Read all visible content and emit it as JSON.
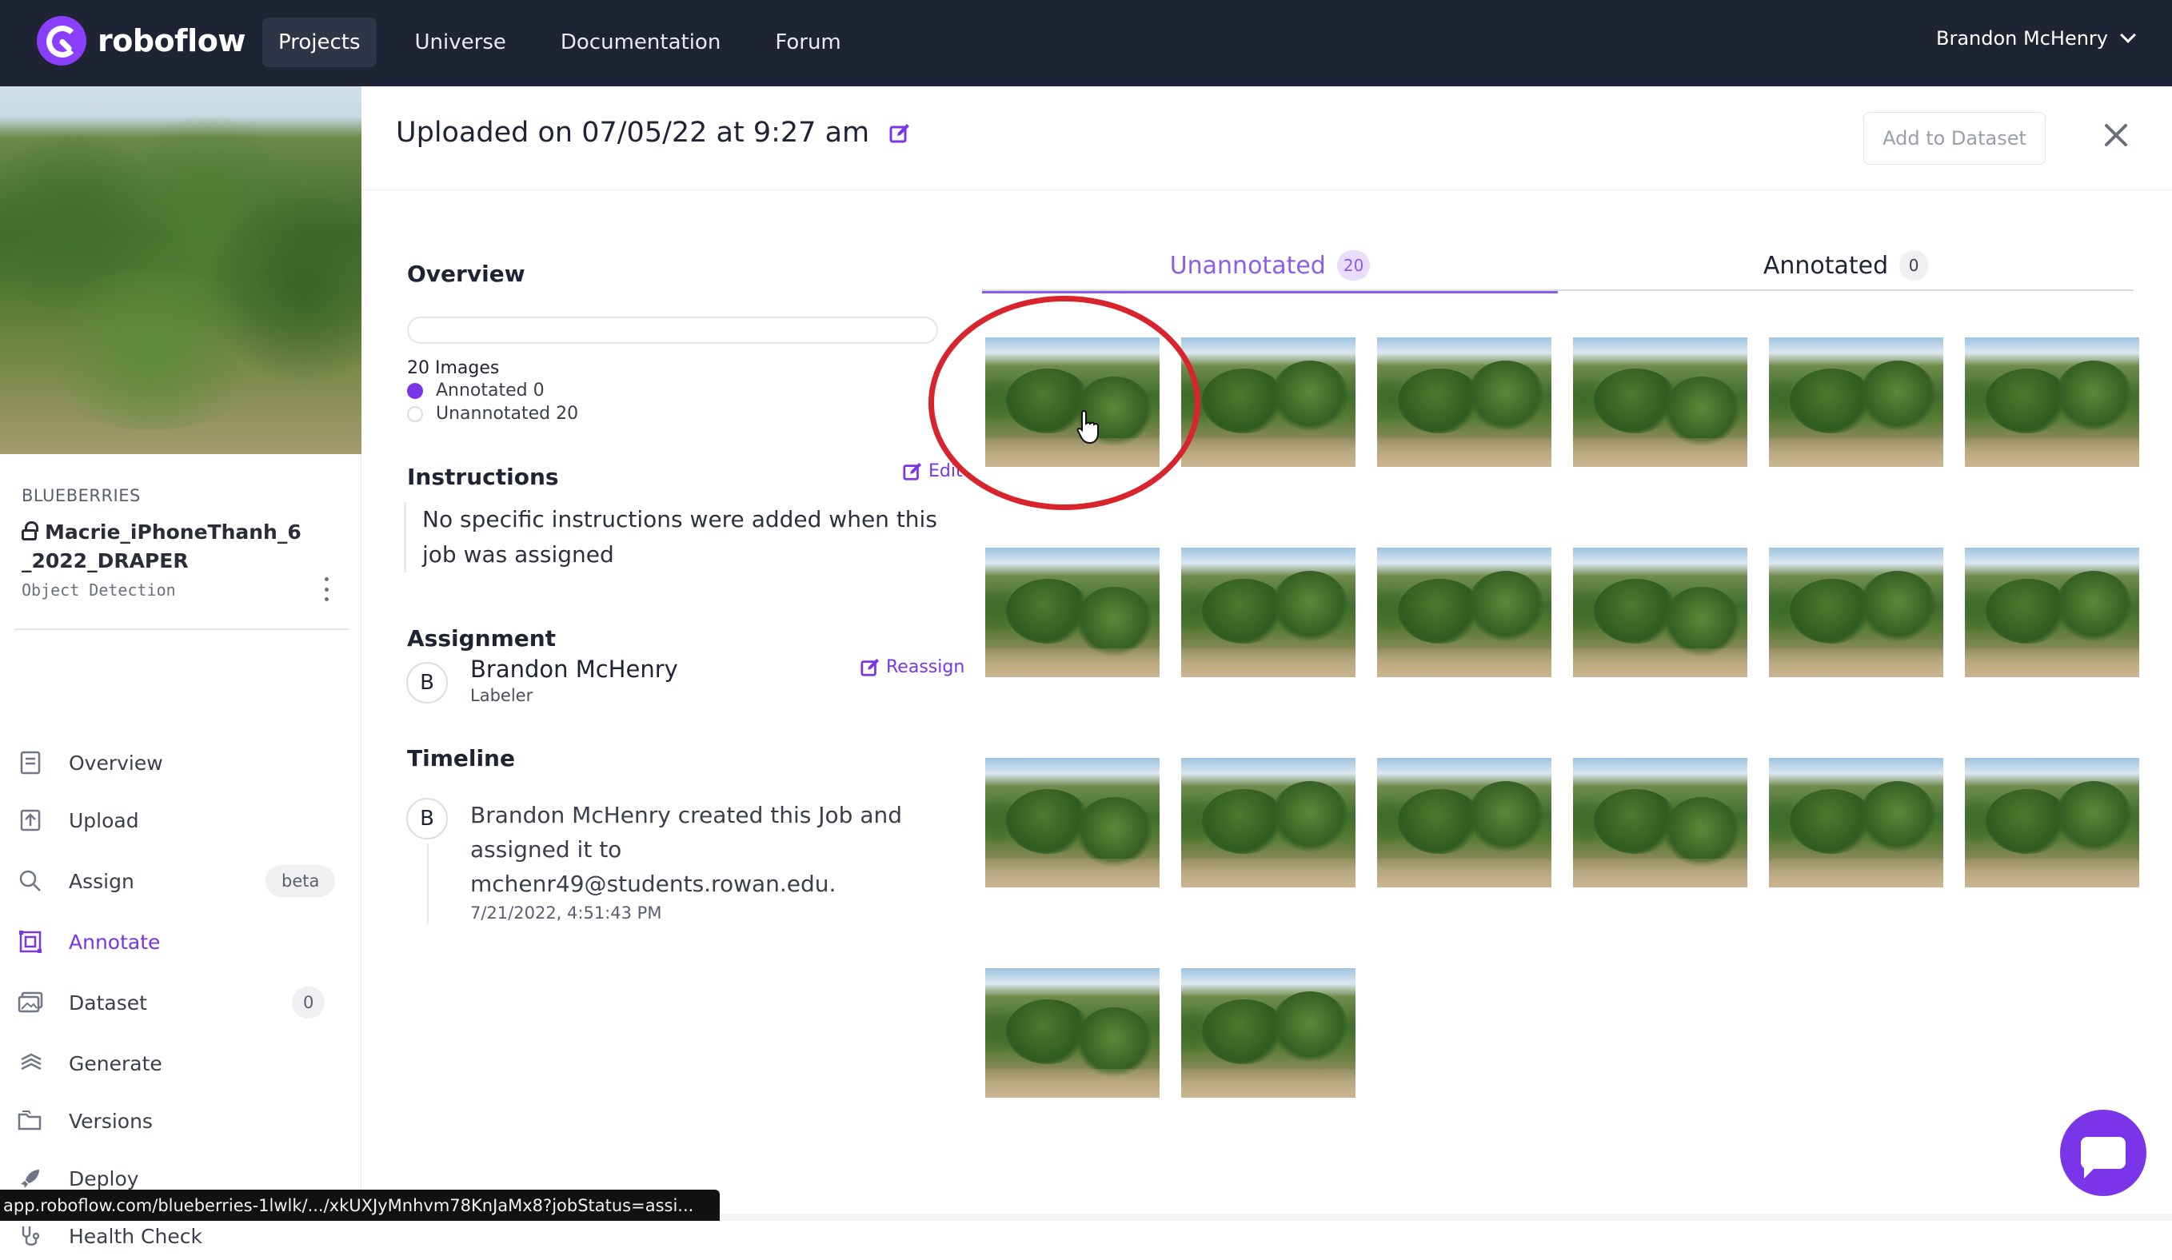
{
  "topbar": {
    "brand": "roboflow",
    "nav": [
      {
        "label": "Projects",
        "active": true
      },
      {
        "label": "Universe"
      },
      {
        "label": "Documentation"
      },
      {
        "label": "Forum"
      }
    ],
    "user": "Brandon McHenry"
  },
  "sidebar": {
    "category": "BLUEBERRIES",
    "project_name": "Macrie_iPhoneThanh_6_2022_DRAPER",
    "project_type": "Object Detection",
    "items": [
      {
        "label": "Overview",
        "icon": "document-icon"
      },
      {
        "label": "Upload",
        "icon": "upload-icon"
      },
      {
        "label": "Assign",
        "icon": "search-icon",
        "badge": "beta"
      },
      {
        "label": "Annotate",
        "icon": "annotate-icon",
        "active": true
      },
      {
        "label": "Dataset",
        "icon": "images-icon",
        "badge": "0"
      },
      {
        "label": "Generate",
        "icon": "generate-icon"
      },
      {
        "label": "Versions",
        "icon": "folders-icon"
      },
      {
        "label": "Deploy",
        "icon": "rocket-icon"
      },
      {
        "label": "Health Check",
        "icon": "stethoscope-icon"
      }
    ]
  },
  "header": {
    "title": "Uploaded on 07/05/22 at 9:27 am",
    "add_button": "Add to Dataset"
  },
  "overview": {
    "title": "Overview",
    "images_count": "20 Images",
    "annotated": "Annotated 0",
    "unannotated": "Unannotated 20",
    "annotated_color": "#7b35e8",
    "progress": 0
  },
  "instructions": {
    "title": "Instructions",
    "edit_label": "Edit",
    "text": "No specific instructions were added when this job was assigned"
  },
  "assignment": {
    "title": "Assignment",
    "avatar": "B",
    "name": "Brandon McHenry",
    "role": "Labeler",
    "reassign_label": "Reassign"
  },
  "timeline": {
    "title": "Timeline",
    "avatar": "B",
    "text": "Brandon McHenry created this Job and assigned it to mchenr49@students.rowan.edu.",
    "time": "7/21/2022, 4:51:43 PM"
  },
  "tabs": [
    {
      "label": "Unannotated",
      "count": "20",
      "active": true
    },
    {
      "label": "Annotated",
      "count": "0"
    }
  ],
  "images": {
    "count": 20
  },
  "status_url": "app.roboflow.com/blueberries-1lwlk/.../xkUXJyMnhvm78KnJaMx8?jobStatus=assi..."
}
